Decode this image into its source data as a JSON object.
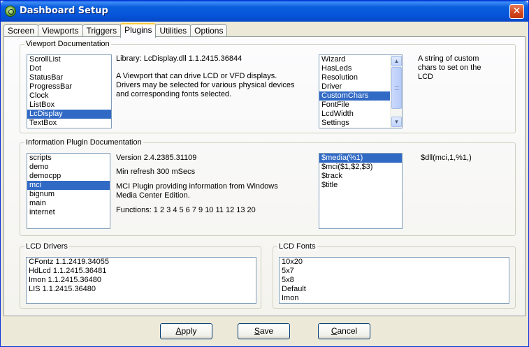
{
  "window": {
    "title": "Dashboard Setup",
    "close_glyph": "✕"
  },
  "tabs": [
    "Screen",
    "Viewports",
    "Triggers",
    "Plugins",
    "Utilities",
    "Options"
  ],
  "active_tab": "Plugins",
  "viewport_doc": {
    "legend": "Viewport Documentation",
    "list": [
      "ScrollList",
      "Dot",
      "StatusBar",
      "ProgressBar",
      "Clock",
      "ListBox",
      "LcDisplay",
      "TextBox"
    ],
    "selected": "LcDisplay",
    "library": "Library: LcDisplay.dll  1.1.2415.36844",
    "description": "A Viewport that can drive LCD or VFD displays.  Drivers may be selected for various physical devices and corresponding fonts selected.",
    "properties": [
      "Wizard",
      "HasLeds",
      "Resolution",
      "Driver",
      "CustomChars",
      "FontFile",
      "LcdWidth",
      "Settings"
    ],
    "selected_property": "CustomChars",
    "property_description": "A string of custom chars to set on the LCD"
  },
  "info_plugin_doc": {
    "legend": "Information Plugin Documentation",
    "list": [
      "scripts",
      "demo",
      "democpp",
      "mci",
      "bignum",
      "main",
      "internet"
    ],
    "selected": "mci",
    "version": "Version 2.4.2385.31109",
    "refresh": "Min refresh 300 mSecs",
    "description": "MCI Plugin providing information from Windows Media Center Edition.",
    "functions": "Functions: 1 2 3 4 5 6 7 9 10 11 12 13 20",
    "function_list": [
      "$media(%1)",
      "$mci($1,$2,$3)",
      "$track",
      "$title"
    ],
    "selected_function": "$media(%1)",
    "function_description": "$dll(mci,1,%1,)"
  },
  "lcd_drivers": {
    "legend": "LCD Drivers",
    "list": [
      "CFontz  1.1.2419.34055",
      "HdLcd  1.1.2415.36481",
      "Imon  1.1.2415.36480",
      "LIS  1.1.2415.36480"
    ]
  },
  "lcd_fonts": {
    "legend": "LCD Fonts",
    "list": [
      "10x20",
      "5x7",
      "5x8",
      "Default",
      "Imon"
    ]
  },
  "buttons": {
    "apply": {
      "mnemonic": "A",
      "rest": "pply"
    },
    "save": {
      "mnemonic": "S",
      "rest": "ave"
    },
    "cancel": {
      "mnemonic": "C",
      "rest": "ancel"
    }
  },
  "colors": {
    "selection": "#316ac5",
    "titlebar": "#0a5fdd",
    "close": "#d2441d"
  }
}
